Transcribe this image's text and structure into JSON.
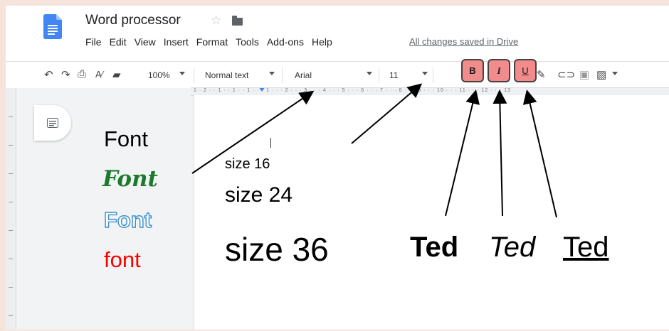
{
  "header": {
    "title": "Word processor",
    "menu": [
      "File",
      "Edit",
      "View",
      "Insert",
      "Format",
      "Tools",
      "Add-ons",
      "Help"
    ],
    "saved_status": "All changes saved in Drive"
  },
  "toolbar": {
    "zoom": "100%",
    "style": "Normal text",
    "font": "Arial",
    "font_size": "11",
    "bold_label": "B",
    "italic_label": "I",
    "underline_label": "U",
    "text_color_label": "A"
  },
  "ruler": {
    "text": "1 · 2 · · 1 · · 1 · · 1 · · · 1 · · · 2 · · · 3 · · · 4 · · · 5 · · · 6 · · · 7 · · · 8 · · · 9 · · · 10 · · · 11 · · · 12 · · · 13"
  },
  "annotations": {
    "font_samples": [
      "Font",
      "Font",
      "Font",
      "font"
    ],
    "sizes": [
      "size 16",
      "size 24",
      "size 36"
    ],
    "ted_bold": "Ted",
    "ted_italic": "Ted",
    "ted_underline": "Ted"
  },
  "colors": {
    "doc_blue": "#4285f4",
    "highlight_button": "#f28b8b",
    "font_green": "#1b7a2c",
    "font_blue": "#3a8fc9",
    "font_red": "#ff0000"
  }
}
